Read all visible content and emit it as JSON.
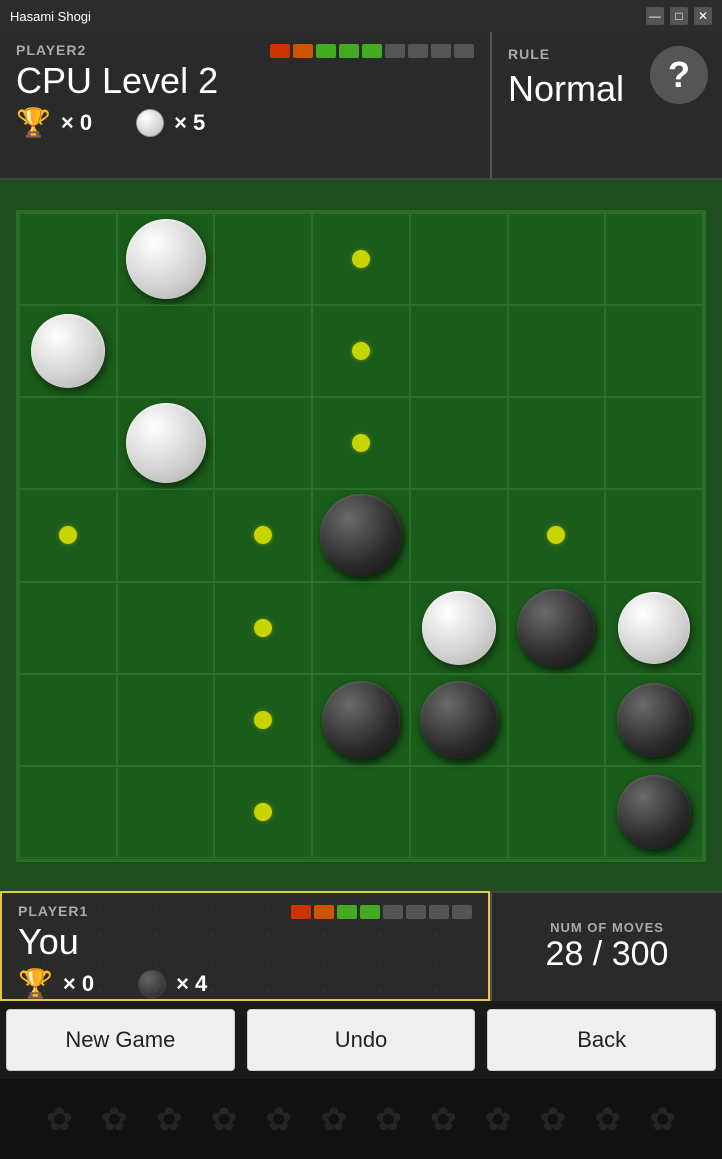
{
  "window": {
    "title": "Hasami Shogi",
    "controls": [
      "—",
      "□",
      "✕"
    ]
  },
  "player2": {
    "label": "PLAYER2",
    "name": "CPU Level 2",
    "trophy_count": "× 0",
    "piece_count": "× 5",
    "piece_type": "white"
  },
  "rule": {
    "label": "RULE",
    "value": "Normal"
  },
  "player1": {
    "label": "PLAYER1",
    "name": "You",
    "trophy_count": "× 0",
    "piece_count": "× 4",
    "piece_type": "dark"
  },
  "moves": {
    "label": "NUM OF MOVES",
    "value": "28 / 300"
  },
  "buttons": {
    "new_game": "New Game",
    "undo": "Undo",
    "back": "Back"
  },
  "board": {
    "cols": 7,
    "rows": 7,
    "pieces": [
      {
        "row": 0,
        "col": 1,
        "type": "white",
        "size": 80
      },
      {
        "row": 1,
        "col": 0,
        "type": "white",
        "size": 74
      },
      {
        "row": 2,
        "col": 1,
        "type": "white",
        "size": 80
      },
      {
        "row": 3,
        "col": 3,
        "type": "black",
        "size": 82
      },
      {
        "row": 4,
        "col": 4,
        "type": "white",
        "size": 74
      },
      {
        "row": 4,
        "col": 5,
        "type": "black",
        "size": 78
      },
      {
        "row": 4,
        "col": 6,
        "type": "white",
        "size": 72
      },
      {
        "row": 5,
        "col": 3,
        "type": "black",
        "size": 78
      },
      {
        "row": 5,
        "col": 4,
        "type": "black",
        "size": 78
      },
      {
        "row": 5,
        "col": 6,
        "type": "black",
        "size": 74
      },
      {
        "row": 6,
        "col": 6,
        "type": "black",
        "size": 74
      }
    ],
    "dots": [
      {
        "row": 0,
        "col": 3
      },
      {
        "row": 1,
        "col": 3
      },
      {
        "row": 2,
        "col": 3
      },
      {
        "row": 3,
        "col": 0
      },
      {
        "row": 3,
        "col": 2
      },
      {
        "row": 3,
        "col": 5
      },
      {
        "row": 4,
        "col": 2
      },
      {
        "row": 5,
        "col": 2
      },
      {
        "row": 6,
        "col": 2
      }
    ]
  }
}
